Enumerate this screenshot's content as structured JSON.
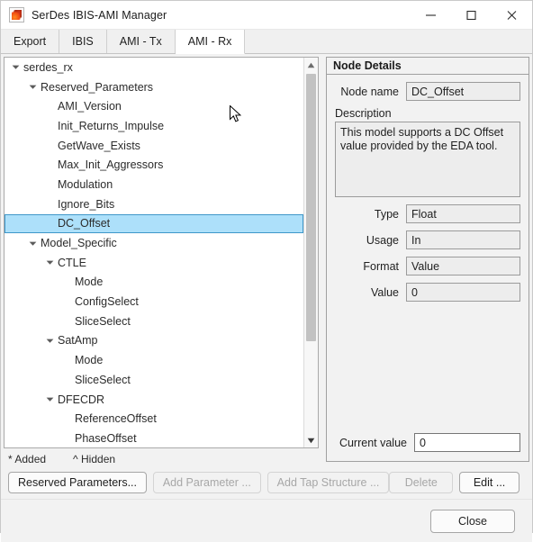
{
  "window": {
    "title": "SerDes IBIS-AMI Manager",
    "icon": "matlab-app-icon",
    "controls": [
      {
        "name": "minimize",
        "icon": "minimize-icon"
      },
      {
        "name": "maximize",
        "icon": "maximize-icon"
      },
      {
        "name": "close",
        "icon": "close-icon"
      }
    ]
  },
  "tabs": [
    {
      "label": "Export",
      "active": false
    },
    {
      "label": "IBIS",
      "active": false
    },
    {
      "label": "AMI - Tx",
      "active": false
    },
    {
      "label": "AMI - Rx",
      "active": true
    }
  ],
  "tree": {
    "rows": [
      {
        "label": "serdes_rx",
        "indent": 0,
        "twisty": "expanded",
        "selected": false
      },
      {
        "label": "Reserved_Parameters",
        "indent": 1,
        "twisty": "expanded",
        "selected": false
      },
      {
        "label": "AMI_Version",
        "indent": 2,
        "twisty": "none",
        "selected": false
      },
      {
        "label": "Init_Returns_Impulse",
        "indent": 2,
        "twisty": "none",
        "selected": false
      },
      {
        "label": "GetWave_Exists",
        "indent": 2,
        "twisty": "none",
        "selected": false
      },
      {
        "label": "Max_Init_Aggressors",
        "indent": 2,
        "twisty": "none",
        "selected": false
      },
      {
        "label": "Modulation",
        "indent": 2,
        "twisty": "none",
        "selected": false
      },
      {
        "label": "Ignore_Bits",
        "indent": 2,
        "twisty": "none",
        "selected": false
      },
      {
        "label": "DC_Offset",
        "indent": 2,
        "twisty": "none",
        "selected": true
      },
      {
        "label": "Model_Specific",
        "indent": 1,
        "twisty": "expanded",
        "selected": false
      },
      {
        "label": "CTLE",
        "indent": 2,
        "twisty": "expanded",
        "selected": false
      },
      {
        "label": "Mode",
        "indent": 3,
        "twisty": "none",
        "selected": false
      },
      {
        "label": "ConfigSelect",
        "indent": 3,
        "twisty": "none",
        "selected": false
      },
      {
        "label": "SliceSelect",
        "indent": 3,
        "twisty": "none",
        "selected": false
      },
      {
        "label": "SatAmp",
        "indent": 2,
        "twisty": "expanded",
        "selected": false
      },
      {
        "label": "Mode",
        "indent": 3,
        "twisty": "none",
        "selected": false
      },
      {
        "label": "SliceSelect",
        "indent": 3,
        "twisty": "none",
        "selected": false
      },
      {
        "label": "DFECDR",
        "indent": 2,
        "twisty": "expanded",
        "selected": false
      },
      {
        "label": "ReferenceOffset",
        "indent": 3,
        "twisty": "none",
        "selected": false
      },
      {
        "label": "PhaseOffset",
        "indent": 3,
        "twisty": "none",
        "selected": false
      }
    ],
    "scrollbar": {
      "up_icon": "scroll-up-arrow",
      "down_icon": "scroll-down-arrow"
    }
  },
  "legend": {
    "added": "* Added",
    "hidden": "^ Hidden"
  },
  "details": {
    "header": "Node Details",
    "node_name_label": "Node name",
    "node_name_value": "DC_Offset",
    "description_label": "Description",
    "description_value": "This model supports a DC Offset value provided by the EDA tool.",
    "type_label": "Type",
    "type_value": "Float",
    "usage_label": "Usage",
    "usage_value": "In",
    "format_label": "Format",
    "format_value": "Value",
    "value_label": "Value",
    "value_value": "0",
    "current_value_label": "Current value",
    "current_value_value": "0"
  },
  "actions": {
    "reserved_parameters": "Reserved Parameters...",
    "add_parameter": "Add Parameter ...",
    "add_tap_structure": "Add Tap Structure ...",
    "delete": "Delete",
    "edit": "Edit ..."
  },
  "footer": {
    "close": "Close"
  },
  "colors": {
    "selection": "#ade0fa",
    "selection_border": "#3f97c9",
    "window_bg": "#f2f2f2",
    "field_readonly_bg": "#ededed",
    "field_editable_bg": "#ffffff"
  }
}
